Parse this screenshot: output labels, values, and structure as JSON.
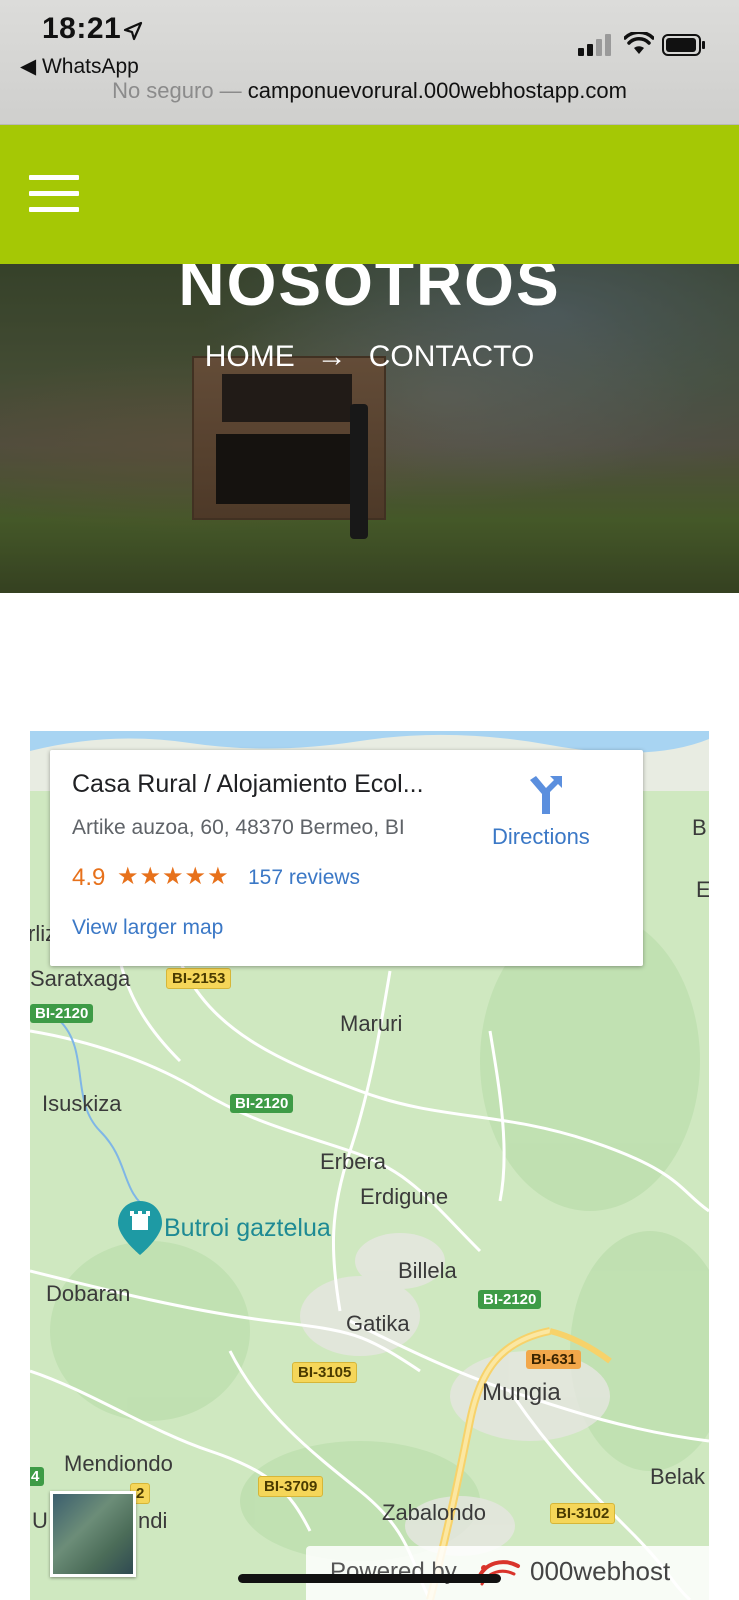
{
  "status_bar": {
    "time": "18:21",
    "back_app": "◀ WhatsApp"
  },
  "browser": {
    "url_prefix": "No seguro — ",
    "url_host": "camponuevorural.000webhostapp.com"
  },
  "header": {
    "bg_color": "#a5c805",
    "menu_icon": "hamburger-menu-icon"
  },
  "hero": {
    "title": "NOSOTROS",
    "breadcrumb_home": "HOME",
    "breadcrumb_arrow": "→",
    "breadcrumb_current": "CONTACTO"
  },
  "map_card": {
    "name": "Casa Rural / Alojamiento Ecol...",
    "address": "Artike auzoa, 60, 48370 Bermeo, BI",
    "rating": "4.9",
    "stars": "★★★★★",
    "reviews": "157 reviews",
    "directions": "Directions",
    "view_larger": "View larger map"
  },
  "map": {
    "places": [
      "Saratxaga",
      "Maruri",
      "Isuskiza",
      "Erbera",
      "Erdigune",
      "Butroi gaztelua",
      "Billela",
      "Dobaran",
      "Gatika",
      "Mungia",
      "Mendiondo",
      "Zabalondo",
      "Belak",
      "U",
      "ndi",
      "rliz",
      "B",
      "E"
    ],
    "roads": [
      "BI-2153",
      "BI-2120",
      "BI-2120",
      "BI-2120",
      "BI-631",
      "BI-3105",
      "BI-3709",
      "BI-3102",
      "2",
      "4"
    ]
  },
  "footer": {
    "powered_by": "Powered by",
    "brand": "000webhost"
  }
}
